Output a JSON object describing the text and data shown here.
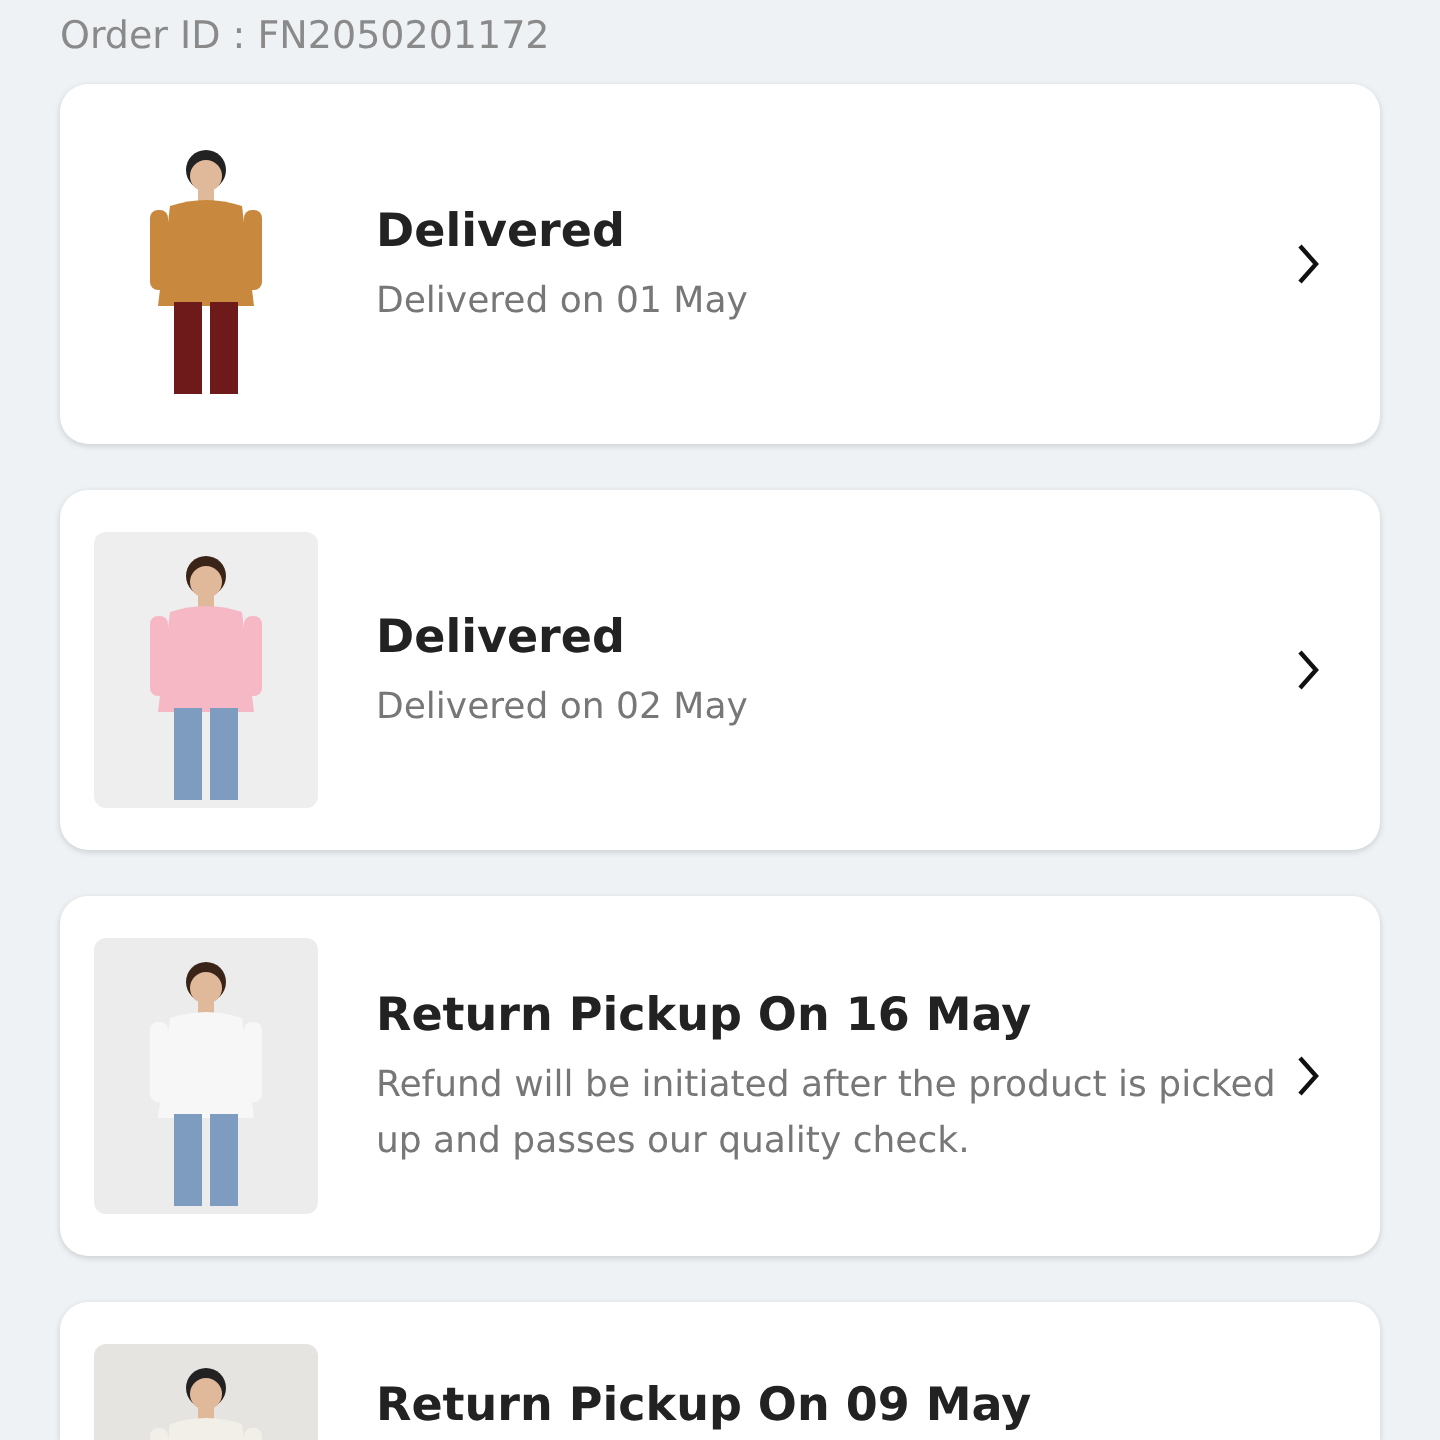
{
  "order_id": "Order ID : FN2050201172",
  "items": [
    {
      "title": "Delivered",
      "detail": "Delivered on 01 May"
    },
    {
      "title": "Delivered",
      "detail": "Delivered on 02 May"
    },
    {
      "title": "Return Pickup On 16 May",
      "detail": "Refund will be initiated after the product is picked up and passes our quality check."
    },
    {
      "title": "Return Pickup On 09 May"
    }
  ]
}
